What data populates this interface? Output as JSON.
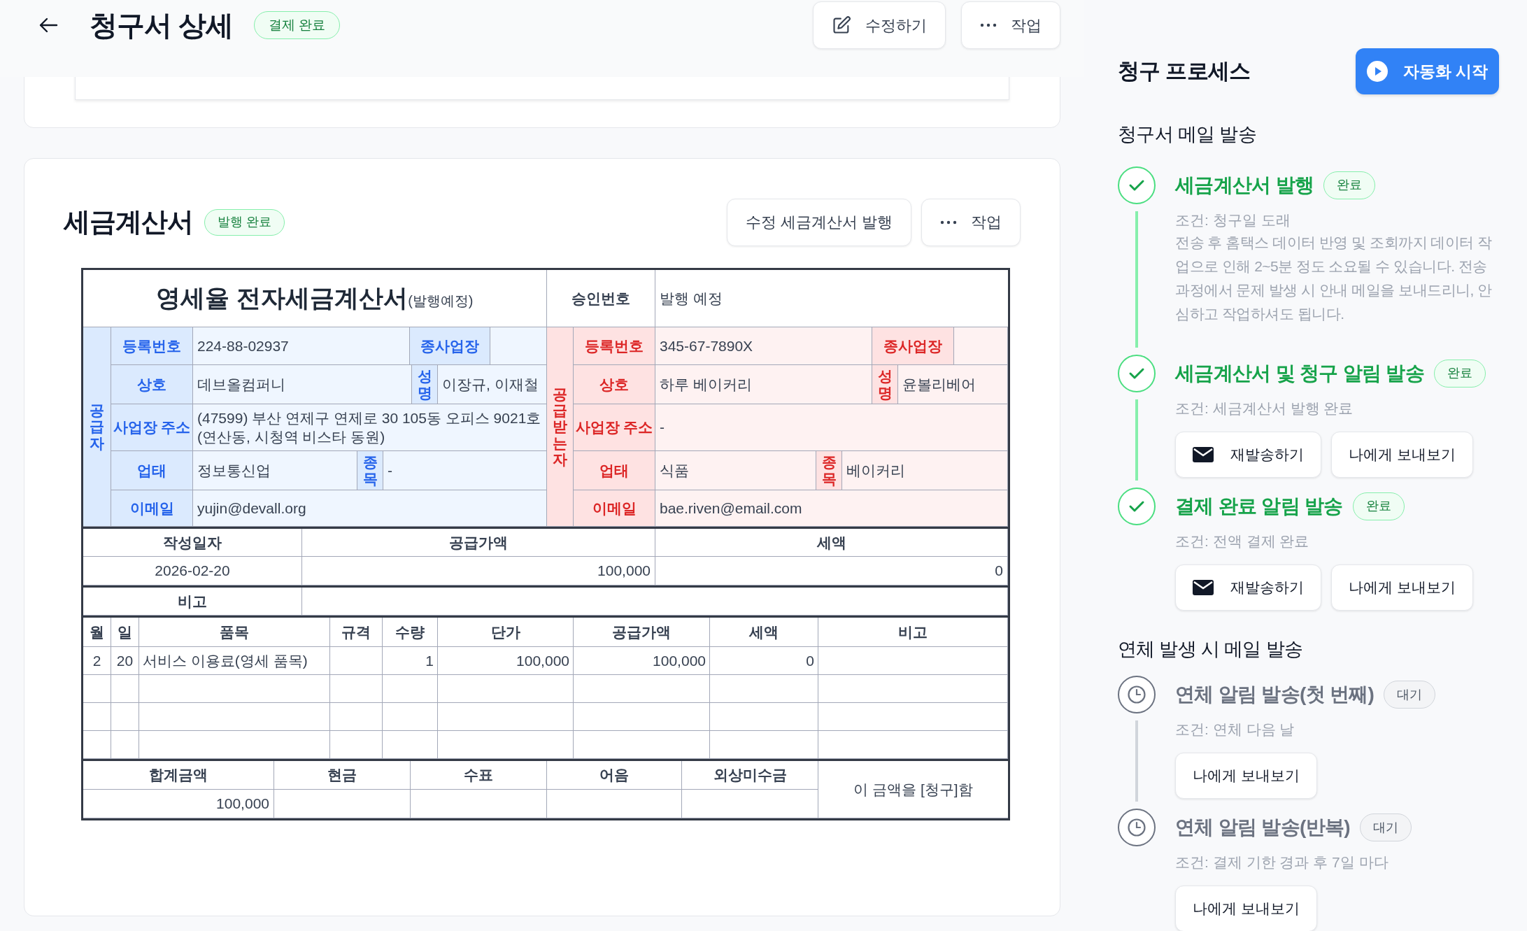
{
  "header": {
    "title": "청구서 상세",
    "status": "결제 완료",
    "buttons": [
      {
        "kind": "edit",
        "label": "수정하기"
      },
      {
        "kind": "more",
        "label": "작업"
      }
    ]
  },
  "tax_invoice": {
    "title": "세금계산서",
    "status": "발행 완료",
    "buttons": [
      {
        "kind": "plain",
        "label": "수정 세금계산서 발행"
      },
      {
        "kind": "more",
        "label": "작업"
      }
    ],
    "document": {
      "title": "영세율 전자세금계산서",
      "title_note": "(발행예정)",
      "approval_label": "승인번호",
      "approval_value": "발행 예정",
      "parties": [
        {
          "kind": "supplier",
          "label": "공급자",
          "reg_label": "등록번호",
          "reg_no": "224-88-02937",
          "branch_label": "종사업장",
          "name_label": "상호",
          "name": "데브올컴퍼니",
          "rep_label": "성명",
          "rep": "이장규, 이재철",
          "address_label": "사업장 주소",
          "address": "(47599) 부산 연제구 연제로 30 105동 오피스 9021호(연산동, 시청역 비스타 동원)",
          "business_label": "업태",
          "business": "정보통신업",
          "item_label": "종목",
          "item": "-",
          "email_label": "이메일",
          "email": "yujin@devall.org"
        },
        {
          "kind": "receiver",
          "label": "공급받는자",
          "reg_label": "등록번호",
          "reg_no": "345-67-7890X",
          "branch_label": "종사업장",
          "name_label": "상호",
          "name": "하루 베이커리",
          "rep_label": "성명",
          "rep": "윤볼리베어",
          "address_label": "사업장 주소",
          "address": "-",
          "business_label": "업태",
          "business": "식품",
          "item_label": "종목",
          "item": "베이커리",
          "email_label": "이메일",
          "email": "bae.riven@email.com"
        }
      ],
      "summary": {
        "columns": [
          "작성일자",
          "공급가액",
          "세액"
        ],
        "values": [
          "2026-02-20",
          "100,000",
          "0"
        ],
        "note_label": "비고"
      },
      "items": {
        "columns": [
          "월",
          "일",
          "품목",
          "규격",
          "수량",
          "단가",
          "공급가액",
          "세액",
          "비고"
        ],
        "rows": [
          {
            "month": "2",
            "day": "20",
            "name": "서비스 이용료(영세 품목)",
            "quantity": "1",
            "unit_price": "100,000",
            "supply": "100,000",
            "tax": "0"
          }
        ]
      },
      "totals": {
        "columns": [
          "합계금액",
          "현금",
          "수표",
          "어음",
          "외상미수금"
        ],
        "total": "100,000",
        "statement": "이 금액을 [청구]함"
      }
    }
  },
  "process": {
    "title": "청구 프로세스",
    "start_button": "자동화 시작",
    "sections": [
      {
        "title": "청구서 메일 발송",
        "steps": [
          {
            "done": true,
            "title": "세금계산서 발행",
            "badge": "완료",
            "condition": "조건: 청구일 도래",
            "description": "전송 후 홈택스 데이터 반영 및 조회까지 데이터 작업으로 인해 2~5분 정도 소요될 수 있습니다. 전송 과정에서 문제 발생 시 안내 메일을 보내드리니, 안심하고 작업하셔도 됩니다."
          },
          {
            "done": true,
            "title": "세금계산서 및 청구 알림 발송",
            "badge": "완료",
            "condition": "조건: 세금계산서 발행 완료",
            "buttons": [
              {
                "kind": "resend",
                "label": "재발송하기"
              },
              {
                "kind": "test",
                "label": "나에게 보내보기"
              }
            ]
          },
          {
            "done": true,
            "title": "결제 완료 알림 발송",
            "badge": "완료",
            "condition": "조건: 전액 결제 완료",
            "buttons": [
              {
                "kind": "resend",
                "label": "재발송하기"
              },
              {
                "kind": "test",
                "label": "나에게 보내보기"
              }
            ]
          }
        ]
      },
      {
        "title": "연체 발생 시 메일 발송",
        "steps": [
          {
            "done": false,
            "title": "연체 알림 발송(첫 번째)",
            "badge": "대기",
            "condition": "조건: 연체 다음 날",
            "buttons": [
              {
                "kind": "test",
                "label": "나에게 보내보기"
              }
            ]
          },
          {
            "done": false,
            "title": "연체 알림 발송(반복)",
            "badge": "대기",
            "condition": "조건: 결제 기한 경과 후 7일 마다",
            "buttons": [
              {
                "kind": "test",
                "label": "나에게 보내보기"
              }
            ]
          }
        ]
      }
    ]
  }
}
